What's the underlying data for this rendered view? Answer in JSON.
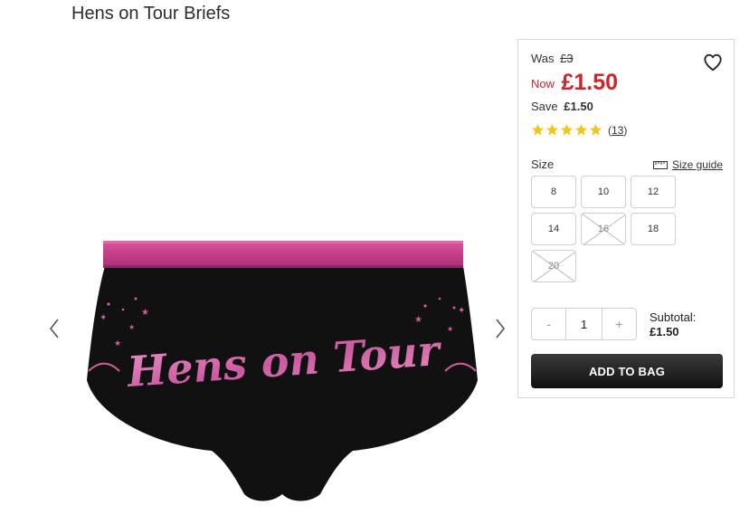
{
  "product": {
    "title": "Hens on Tour Briefs",
    "image_text": "Hens on Tour",
    "image_description_icon": "briefs-image"
  },
  "pricing": {
    "was_label": "Was",
    "was_price": "£3",
    "now_label": "Now",
    "now_price": "£1.50",
    "save_label": "Save",
    "save_amount": "£1.50",
    "price_color": "#d2232a"
  },
  "rating": {
    "stars": 5,
    "review_count": "13",
    "open_paren": "(",
    "close_paren": ")",
    "star_color": "#f5c518"
  },
  "size": {
    "label": "Size",
    "guide_label": "Size guide",
    "options": [
      {
        "label": "8",
        "available": true
      },
      {
        "label": "10",
        "available": true
      },
      {
        "label": "12",
        "available": true
      },
      {
        "label": "14",
        "available": true
      },
      {
        "label": "16",
        "available": false
      },
      {
        "label": "18",
        "available": true
      },
      {
        "label": "20",
        "available": false
      }
    ]
  },
  "quantity": {
    "minus": "-",
    "value": "1",
    "plus": "+"
  },
  "subtotal": {
    "label": "Subtotal:",
    "amount": "£1.50"
  },
  "cta": {
    "add_to_bag": "ADD TO BAG"
  }
}
